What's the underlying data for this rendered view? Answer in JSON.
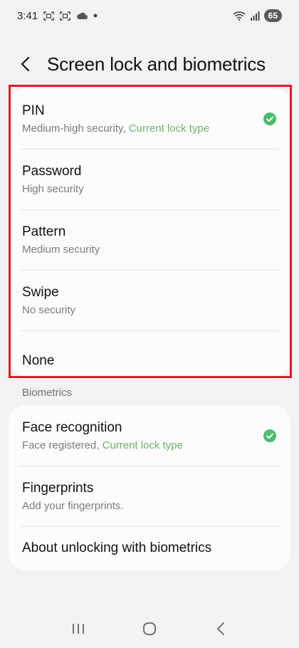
{
  "status_bar": {
    "time": "3:41",
    "battery": "65",
    "icons": [
      "screenshot-icon",
      "screenshot-icon",
      "cloud-icon",
      "dot-icon",
      "wifi-icon",
      "signal-icon"
    ]
  },
  "header": {
    "title": "Screen lock and biometrics",
    "back_icon": "chevron-left-icon"
  },
  "lock_types": [
    {
      "title": "PIN",
      "subtitle": "Medium-high security, ",
      "accent": "Current lock type",
      "selected": true
    },
    {
      "title": "Password",
      "subtitle": "High security",
      "accent": "",
      "selected": false
    },
    {
      "title": "Pattern",
      "subtitle": "Medium security",
      "accent": "",
      "selected": false
    },
    {
      "title": "Swipe",
      "subtitle": "No security",
      "accent": "",
      "selected": false
    },
    {
      "title": "None",
      "subtitle": "",
      "accent": "",
      "selected": false
    }
  ],
  "biometrics": {
    "section_label": "Biometrics",
    "items": [
      {
        "title": "Face recognition",
        "subtitle": "Face registered, ",
        "accent": "Current lock type",
        "selected": true
      },
      {
        "title": "Fingerprints",
        "subtitle": "Add your fingerprints.",
        "accent": "",
        "selected": false
      },
      {
        "title": "About unlocking with biometrics",
        "subtitle": "",
        "accent": "",
        "selected": false
      }
    ]
  },
  "colors": {
    "accent_green": "#6eb36a",
    "check_green": "#4cbb6c",
    "highlight_red": "#e21b23"
  },
  "nav_bar": {
    "icons": [
      "recents-icon",
      "home-icon",
      "back-icon"
    ]
  }
}
